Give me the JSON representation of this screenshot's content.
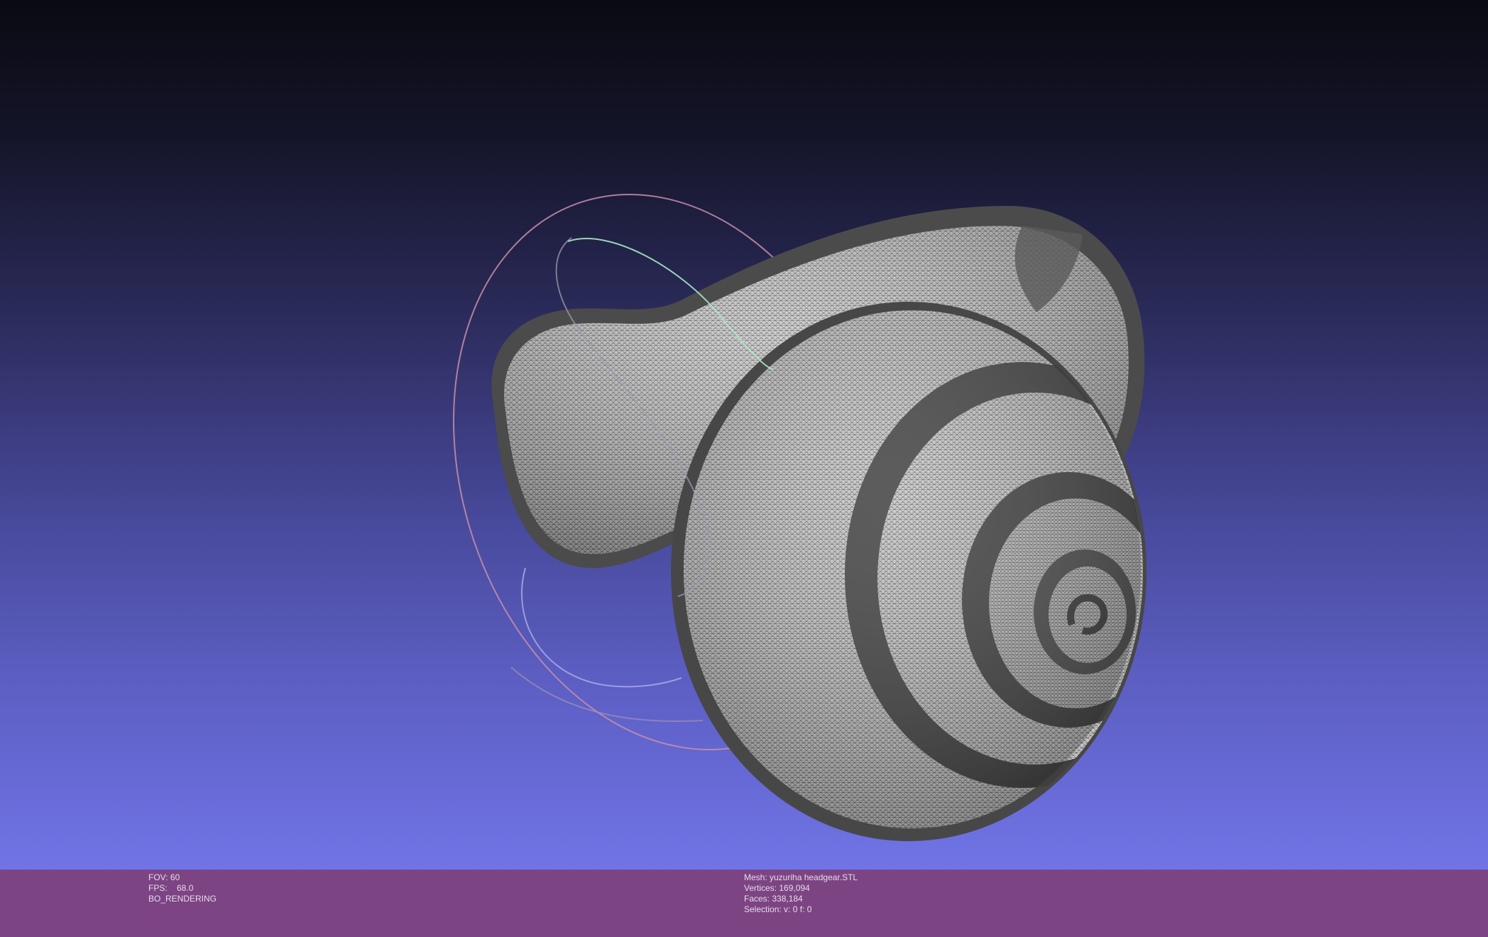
{
  "viewer": {
    "background_top": "#0a0a12",
    "background_bottom": "#7074e6",
    "mesh_color": "#c9c9c9",
    "band_color": "#4a4a4a"
  },
  "info_bar": {
    "color": "#7d4484",
    "left": {
      "fov": "FOV: 60",
      "fps": "FPS:    68.0",
      "mode": "BO_RENDERING"
    },
    "right": {
      "mesh": "Mesh: yuzuriha headgear.STL",
      "vertices": "Vertices: 169,094",
      "faces": "Faces: 338,184",
      "selection": "Selection: v: 0 f: 0"
    }
  }
}
